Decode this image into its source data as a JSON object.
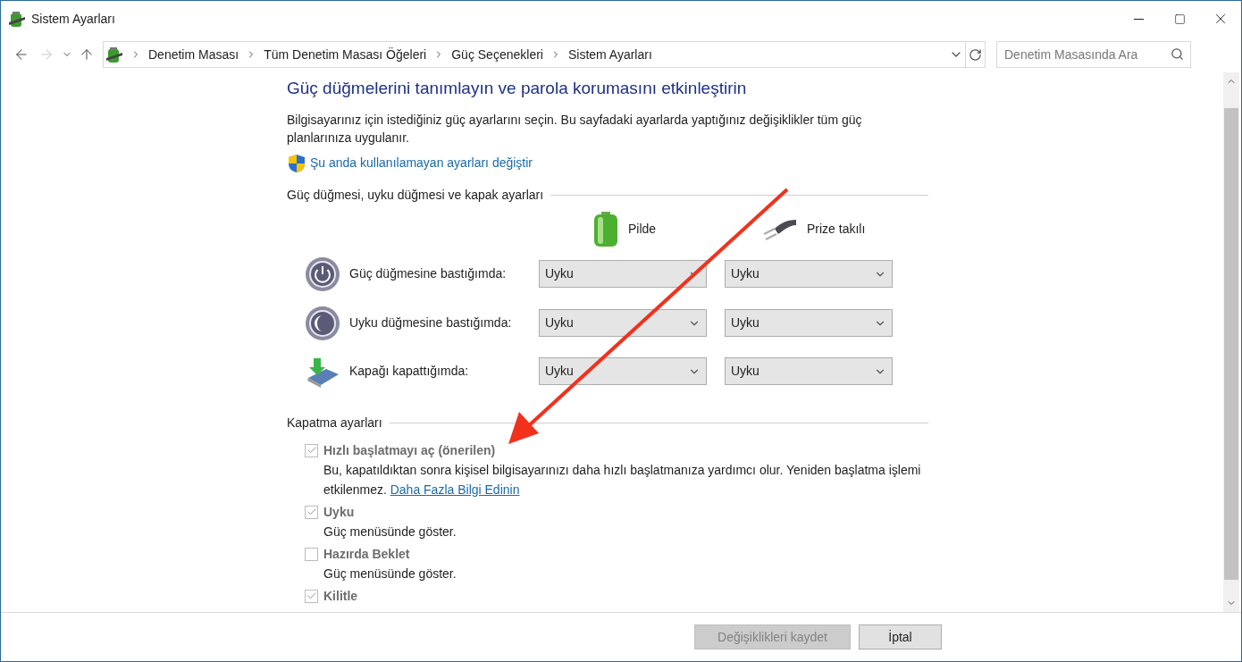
{
  "window": {
    "title": "Sistem Ayarları"
  },
  "address_bar": {
    "breadcrumbs": [
      "Denetim Masası",
      "Tüm Denetim Masası Öğeleri",
      "Güç Seçenekleri",
      "Sistem Ayarları"
    ]
  },
  "search": {
    "placeholder": "Denetim Masasında Ara"
  },
  "heading": "Güç düğmelerini tanımlayın ve parola korumasını etkinleştirin",
  "intro": "Bilgisayarınız için istediğiniz güç ayarlarını seçin. Bu sayfadaki ayarlarda yaptığınız değişiklikler tüm güç planlarınıza uygulanır.",
  "admin_link": "Şu anda kullanılamayan ayarları değiştir",
  "button_section": {
    "title": "Güç düğmesi, uyku düğmesi ve kapak ayarları",
    "columns": [
      {
        "kind": "battery",
        "label": "Pilde"
      },
      {
        "kind": "plug",
        "label": "Prize takılı"
      }
    ],
    "rows": [
      {
        "kind": "power",
        "label": "Güç düğmesine bastığımda:",
        "values": [
          "Uyku",
          "Uyku"
        ]
      },
      {
        "kind": "sleep",
        "label": "Uyku düğmesine bastığımda:",
        "values": [
          "Uyku",
          "Uyku"
        ]
      },
      {
        "kind": "lid",
        "label": "Kapağı kapattığımda:",
        "values": [
          "Uyku",
          "Uyku"
        ]
      }
    ]
  },
  "shutdown_section": {
    "title": "Kapatma ayarları",
    "options": [
      {
        "label": "Hızlı başlatmayı aç (önerilen)",
        "checked": true,
        "disabled": true,
        "description": "Bu, kapatıldıktan sonra kişisel bilgisayarınızı daha hızlı başlatmanıza yardımcı olur. Yeniden başlatma işlemi etkilenmez.",
        "link": "Daha Fazla Bilgi Edinin"
      },
      {
        "label": "Uyku",
        "checked": true,
        "disabled": true,
        "description": "Güç menüsünde göster."
      },
      {
        "label": "Hazırda Beklet",
        "checked": false,
        "disabled": true,
        "description": "Güç menüsünde göster."
      },
      {
        "label": "Kilitle",
        "checked": true,
        "disabled": true
      }
    ]
  },
  "buttons": [
    {
      "label": "Değişiklikleri kaydet",
      "disabled": true
    },
    {
      "label": "İptal",
      "disabled": false
    }
  ]
}
